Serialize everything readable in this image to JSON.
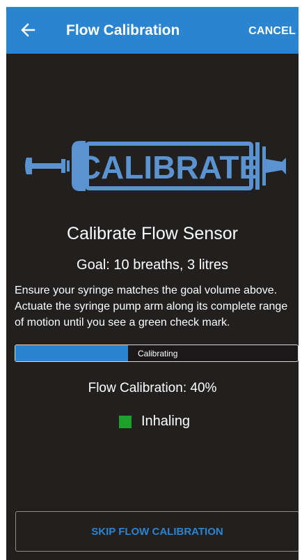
{
  "header": {
    "title": "Flow Calibration",
    "cancel_label": "CANCEL",
    "back_icon": "arrow-left-icon",
    "color": "#2b84cf"
  },
  "graphic": {
    "icon": "syringe-icon",
    "text": "CALIBRATE"
  },
  "main": {
    "heading": "Calibrate Flow Sensor",
    "goal": "Goal: 10 breaths, 3 litres",
    "instructions": "Ensure your syringe matches the goal volume above. Actuate the syringe pump arm along its complete range of motion until you see a green check mark.",
    "progress": {
      "label": "Calibrating",
      "fraction": 0.4
    },
    "calibration_percent": "Flow Calibration: 40%",
    "status": {
      "label": "Inhaling",
      "color": "#1ea12a"
    }
  },
  "footer": {
    "skip_label": "SKIP FLOW CALIBRATION"
  }
}
